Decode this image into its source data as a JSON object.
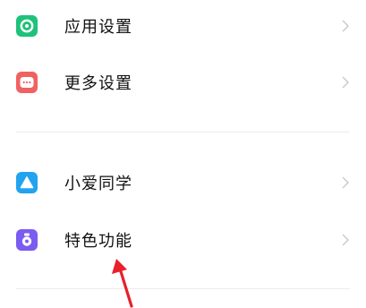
{
  "settings_list": {
    "items": [
      {
        "label": "应用设置",
        "icon": "app-settings-icon",
        "color": "#1ec27a"
      },
      {
        "label": "更多设置",
        "icon": "more-settings-icon",
        "color": "#f06262"
      },
      {
        "label": "小爱同学",
        "icon": "xiaoai-icon",
        "color": "#22a3f0"
      },
      {
        "label": "特色功能",
        "icon": "special-features-icon",
        "color": "#7a5cf0"
      }
    ]
  },
  "colors": {
    "chevron": "#c8c8c8",
    "divider": "#ececec",
    "annotation_arrow": "#e8202a"
  }
}
